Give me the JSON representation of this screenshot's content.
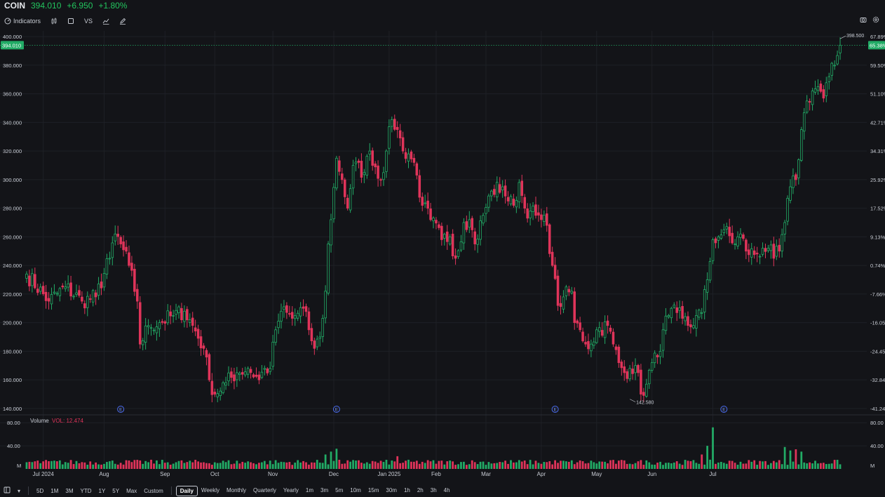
{
  "header": {
    "symbol": "COIN",
    "price": "394.010",
    "change": "+6.950",
    "change_pct": "+1.80%"
  },
  "toolbar": {
    "indicators_label": "Indicators",
    "compare_label": "VS"
  },
  "colors": {
    "up": "#22ab66",
    "down": "#e0345a",
    "bg": "#131418",
    "grid": "#1e2026",
    "text": "#c8ccd4"
  },
  "timeframes": [
    "5D",
    "1M",
    "3M",
    "YTD",
    "1Y",
    "5Y",
    "Max",
    "Custom"
  ],
  "intervals": [
    "Daily",
    "Weekly",
    "Monthly",
    "Quarterly",
    "Yearly",
    "1m",
    "3m",
    "5m",
    "10m",
    "15m",
    "30m",
    "1h",
    "2h",
    "3h",
    "4h"
  ],
  "selected_interval": "Daily",
  "chart_data": {
    "type": "candlestick",
    "symbol": "COIN",
    "last_price": 394.01,
    "last_price_label": "394.010",
    "high_marker": {
      "label": "398.500",
      "value": 398.5
    },
    "low_marker": {
      "label": "142.580",
      "value": 142.58
    },
    "ylim": [
      136,
      404
    ],
    "y_ticks": [
      "140.000",
      "160.000",
      "180.000",
      "200.000",
      "220.000",
      "240.000",
      "260.000",
      "280.000",
      "300.000",
      "320.000",
      "340.000",
      "360.000",
      "380.000",
      "400.000"
    ],
    "pct_ticks": [
      "-41.24%",
      "-32.84%",
      "-24.45%",
      "-16.05%",
      "-7.66%",
      "0.74%",
      "9.13%",
      "17.52%",
      "25.92%",
      "34.31%",
      "42.71%",
      "51.10%",
      "59.50%",
      "67.89%"
    ],
    "pct_label_last": "65.38%",
    "x_labels": [
      "Jul 2024",
      "Aug",
      "Sep",
      "Oct",
      "Nov",
      "Dec",
      "Jan 2025",
      "Feb",
      "Mar",
      "Apr",
      "May",
      "Jun",
      "Jul"
    ],
    "earnings_markers": 4,
    "earnings_label": "E",
    "volume": {
      "title": "Volume",
      "vol_label": "VOL: 12.474",
      "y_ticks": [
        "80.00",
        "40.00"
      ],
      "unit": "M",
      "ylim": [
        0,
        90
      ]
    },
    "price_anchors": [
      [
        0,
        234
      ],
      [
        8,
        215
      ],
      [
        14,
        225
      ],
      [
        20,
        215
      ],
      [
        25,
        218
      ],
      [
        30,
        245
      ],
      [
        32,
        262
      ],
      [
        34,
        255
      ],
      [
        37,
        240
      ],
      [
        40,
        215
      ],
      [
        41,
        185
      ],
      [
        44,
        198
      ],
      [
        48,
        200
      ],
      [
        53,
        205
      ],
      [
        57,
        208
      ],
      [
        60,
        198
      ],
      [
        64,
        182
      ],
      [
        66,
        160
      ],
      [
        68,
        150
      ],
      [
        72,
        158
      ],
      [
        76,
        165
      ],
      [
        80,
        168
      ],
      [
        84,
        160
      ],
      [
        86,
        168
      ],
      [
        88,
        168
      ],
      [
        90,
        195
      ],
      [
        92,
        208
      ],
      [
        96,
        203
      ],
      [
        100,
        210
      ],
      [
        102,
        195
      ],
      [
        104,
        182
      ],
      [
        106,
        190
      ],
      [
        108,
        222
      ],
      [
        109,
        255
      ],
      [
        110,
        272
      ],
      [
        112,
        315
      ],
      [
        114,
        300
      ],
      [
        116,
        280
      ],
      [
        118,
        310
      ],
      [
        122,
        305
      ],
      [
        124,
        320
      ],
      [
        128,
        300
      ],
      [
        130,
        320
      ],
      [
        132,
        342
      ],
      [
        134,
        335
      ],
      [
        136,
        320
      ],
      [
        138,
        318
      ],
      [
        140,
        312
      ],
      [
        143,
        282
      ],
      [
        146,
        272
      ],
      [
        150,
        258
      ],
      [
        153,
        260
      ],
      [
        155,
        245
      ],
      [
        158,
        270
      ],
      [
        160,
        272
      ],
      [
        162,
        255
      ],
      [
        165,
        275
      ],
      [
        168,
        292
      ],
      [
        172,
        295
      ],
      [
        174,
        285
      ],
      [
        176,
        282
      ],
      [
        178,
        298
      ],
      [
        180,
        280
      ],
      [
        182,
        278
      ],
      [
        184,
        275
      ],
      [
        186,
        272
      ],
      [
        188,
        268
      ],
      [
        190,
        240
      ],
      [
        192,
        212
      ],
      [
        194,
        218
      ],
      [
        197,
        222
      ],
      [
        198,
        200
      ],
      [
        200,
        195
      ],
      [
        202,
        185
      ],
      [
        204,
        185
      ],
      [
        206,
        195
      ],
      [
        210,
        198
      ],
      [
        212,
        185
      ],
      [
        214,
        172
      ],
      [
        216,
        165
      ],
      [
        218,
        168
      ],
      [
        220,
        170
      ],
      [
        222,
        150
      ],
      [
        224,
        157
      ],
      [
        226,
        172
      ],
      [
        228,
        176
      ],
      [
        230,
        195
      ],
      [
        232,
        205
      ],
      [
        235,
        207
      ],
      [
        237,
        203
      ],
      [
        240,
        197
      ],
      [
        242,
        205
      ],
      [
        244,
        207
      ],
      [
        246,
        230
      ],
      [
        248,
        258
      ],
      [
        250,
        260
      ],
      [
        252,
        265
      ],
      [
        256,
        255
      ],
      [
        258,
        262
      ],
      [
        260,
        250
      ],
      [
        264,
        248
      ],
      [
        266,
        252
      ],
      [
        268,
        252
      ],
      [
        270,
        245
      ],
      [
        272,
        250
      ],
      [
        274,
        270
      ],
      [
        276,
        295
      ],
      [
        278,
        300
      ],
      [
        280,
        335
      ],
      [
        282,
        355
      ],
      [
        284,
        362
      ],
      [
        286,
        365
      ],
      [
        288,
        357
      ],
      [
        290,
        372
      ],
      [
        292,
        380
      ],
      [
        294,
        394
      ]
    ]
  }
}
